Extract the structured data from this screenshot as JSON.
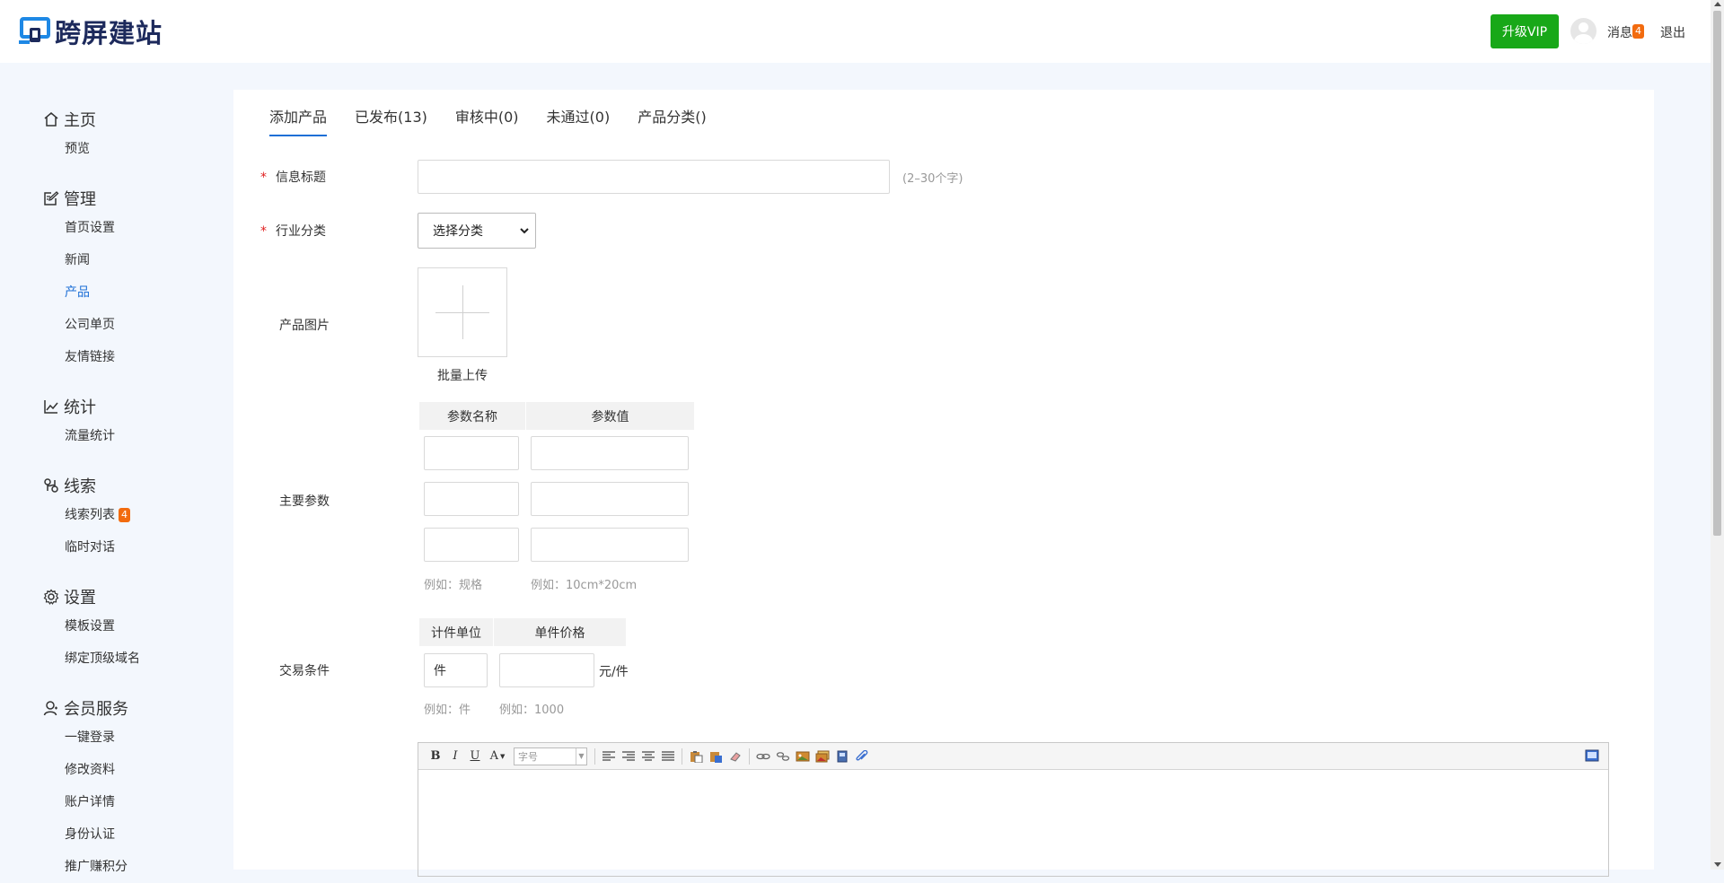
{
  "header": {
    "logo_text": "跨屏建站",
    "vip_label": "升级VIP",
    "messages_label": "消息",
    "messages_count": "4",
    "logout_label": "退出"
  },
  "sidebar": {
    "groups": [
      {
        "icon": "home-icon",
        "title": "主页",
        "items": [
          {
            "label": "预览"
          }
        ]
      },
      {
        "icon": "edit-icon",
        "title": "管理",
        "items": [
          {
            "label": "首页设置"
          },
          {
            "label": "新闻"
          },
          {
            "label": "产品",
            "active": true
          },
          {
            "label": "公司单页"
          },
          {
            "label": "友情链接"
          }
        ]
      },
      {
        "icon": "chart-line-icon",
        "title": "统计",
        "items": [
          {
            "label": "流量统计"
          }
        ]
      },
      {
        "icon": "lead-icon",
        "title": "线索",
        "items": [
          {
            "label": "线索列表",
            "badge": "4"
          },
          {
            "label": "临时对话"
          }
        ]
      },
      {
        "icon": "gear-icon",
        "title": "设置",
        "items": [
          {
            "label": "模板设置"
          },
          {
            "label": "绑定顶级域名"
          }
        ]
      },
      {
        "icon": "user-icon",
        "title": "会员服务",
        "items": [
          {
            "label": "一键登录"
          },
          {
            "label": "修改资料"
          },
          {
            "label": "账户详情"
          },
          {
            "label": "身份认证"
          },
          {
            "label": "推广赚积分"
          }
        ]
      }
    ]
  },
  "tabs": [
    {
      "label": "添加产品",
      "active": true
    },
    {
      "label": "已发布(13)"
    },
    {
      "label": "审核中(0)"
    },
    {
      "label": "未通过(0)"
    },
    {
      "label": "产品分类()"
    }
  ],
  "form": {
    "required_mark": "*",
    "title_label": "信息标题",
    "title_value": "",
    "title_hint": "(2–30个字)",
    "category_label": "行业分类",
    "category_selected": "选择分类",
    "image_label": "产品图片",
    "upload_label": "批量上传",
    "params_label": "主要参数",
    "params_headers": [
      "参数名称",
      "参数值"
    ],
    "param_name_hint": "例如：规格",
    "param_value_hint": "例如：10cm*20cm",
    "trade_label": "交易条件",
    "trade_headers": [
      "计件单位",
      "单件价格"
    ],
    "unit_value": "件",
    "price_value": "",
    "price_suffix": "元/件",
    "unit_hint": "例如：件",
    "price_hint": "例如：1000"
  },
  "editor": {
    "fontsize_placeholder": "字号",
    "bold": "B",
    "italic": "I",
    "underline": "U",
    "fontcolor": "A"
  },
  "colors": {
    "accent": "#1d6fd6",
    "vip_green": "#18a818",
    "badge_orange": "#f26b0f",
    "required_red": "#e02020"
  }
}
